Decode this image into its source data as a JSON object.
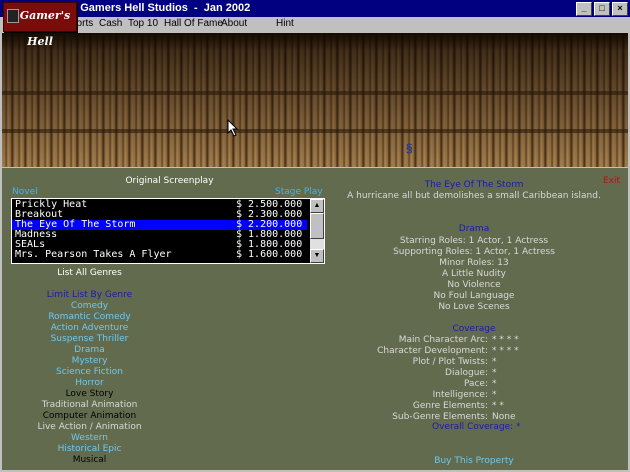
{
  "window": {
    "title": "Gamers Hell Studios  -  Jan 2002",
    "title_fragment": "000",
    "logo_text": "Gamer's Hell",
    "buttons": [
      "_",
      "□",
      "×"
    ]
  },
  "menu": [
    "ports",
    "Cash",
    "Top 10",
    "Hall Of Fame",
    "About",
    "Hint"
  ],
  "screenplays": {
    "header": "Original Screenplay",
    "left_tag": "Novel",
    "right_tag": "Stage Play",
    "items": [
      {
        "name": "Prickly Heat",
        "price": "$ 2.500.000"
      },
      {
        "name": "Breakout",
        "price": "$ 2.300.000"
      },
      {
        "name": "The Eye Of The Storm",
        "price": "$ 2.200.000"
      },
      {
        "name": "Madness",
        "price": "$ 1.800.000"
      },
      {
        "name": "SEALs",
        "price": "$ 1.800.000"
      },
      {
        "name": "Mrs. Pearson Takes A Flyer",
        "price": "$ 1.600.000"
      }
    ],
    "selected_index": 2,
    "list_all": "List All Genres",
    "limit_label": "Limit List By Genre"
  },
  "genres": [
    {
      "label": "Comedy",
      "color": "#6ec9ee"
    },
    {
      "label": "Romantic Comedy",
      "color": "#6ec9ee"
    },
    {
      "label": "Action Adventure",
      "color": "#6ec9ee"
    },
    {
      "label": "Suspense Thriller",
      "color": "#6ec9ee"
    },
    {
      "label": "Drama",
      "color": "#6ec9ee"
    },
    {
      "label": "Mystery",
      "color": "#6ec9ee"
    },
    {
      "label": "Science Fiction",
      "color": "#6ec9ee"
    },
    {
      "label": "Horror",
      "color": "#6ec9ee"
    },
    {
      "label": "Love Story",
      "color": "#000000"
    },
    {
      "label": "Traditional Animation",
      "color": "#d8d8d8"
    },
    {
      "label": "Computer Animation",
      "color": "#000000"
    },
    {
      "label": "Live Action / Animation",
      "color": "#d8d8d8"
    },
    {
      "label": "Western",
      "color": "#6ec9ee"
    },
    {
      "label": "Historical Epic",
      "color": "#6ec9ee"
    },
    {
      "label": "Musical",
      "color": "#000000"
    }
  ],
  "details": {
    "title": "The Eye Of The Storm",
    "exit": "Exit",
    "description": "A hurricane all but demolishes a small Caribbean island.",
    "genre": "Drama",
    "lines": [
      "Starring Roles: 1 Actor, 1 Actress",
      "Supporting Roles: 1 Actor, 1 Actress",
      "Minor Roles:  13",
      "A Little Nudity",
      "No Violence",
      "No Foul Language",
      "No Love Scenes"
    ],
    "coverage_title": "Coverage",
    "coverage": [
      {
        "label": "Main Character Arc:",
        "stars": "*  *  *  *"
      },
      {
        "label": "Character Development:",
        "stars": "*  *  *  *"
      },
      {
        "label": "Plot / Plot Twists:",
        "stars": "*"
      },
      {
        "label": "Dialogue:",
        "stars": "*"
      },
      {
        "label": "Pace:",
        "stars": "*"
      },
      {
        "label": "Intelligence:",
        "stars": "*"
      },
      {
        "label": "Genre Elements:",
        "stars": "*  *"
      },
      {
        "label": "Sub-Genre Elements:",
        "stars": "None"
      }
    ],
    "overall_label": "Overall Coverage:",
    "overall_stars": "*",
    "buy": "Buy This Property"
  },
  "colors": {
    "panel_bg": "#636b4f",
    "titlebar": "#000080",
    "selection": "#0000ff",
    "exit": "#b41212"
  }
}
